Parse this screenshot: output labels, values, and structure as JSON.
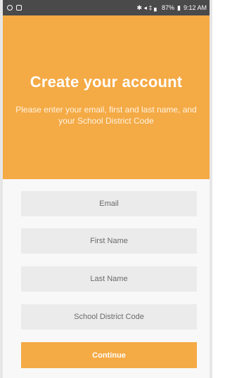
{
  "status_bar": {
    "signal_text": "✱ ◂ ‡ ▖",
    "battery": "87%",
    "time": "9:12 AM"
  },
  "header": {
    "title": "Create your account",
    "subtitle": "Please enter your email, first and last name, and your School District Code",
    "background_color": "#f4aa45"
  },
  "form": {
    "email_placeholder": "Email",
    "first_name_placeholder": "First Name",
    "last_name_placeholder": "Last Name",
    "school_code_placeholder": "School District Code",
    "continue_label": "Continue"
  }
}
